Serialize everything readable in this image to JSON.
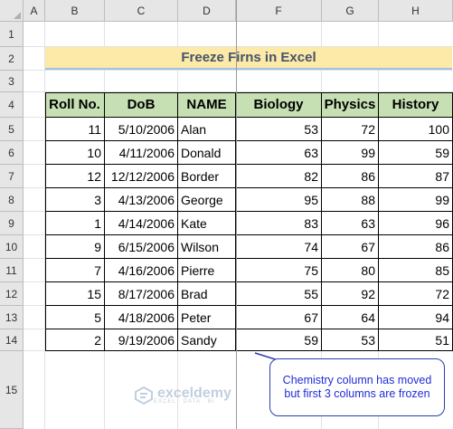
{
  "columns": [
    "A",
    "B",
    "C",
    "D",
    "F",
    "G",
    "H"
  ],
  "rows": [
    "1",
    "2",
    "3",
    "4",
    "5",
    "6",
    "7",
    "8",
    "9",
    "10",
    "11",
    "12",
    "13",
    "14",
    "15"
  ],
  "title": "Freeze Firns in Excel",
  "headers": [
    "Roll No.",
    "DoB",
    "NAME",
    "Biology",
    "Physics",
    "History"
  ],
  "data": [
    [
      "11",
      "5/10/2006",
      "Alan",
      "53",
      "72",
      "100"
    ],
    [
      "10",
      "4/11/2006",
      "Donald",
      "63",
      "99",
      "59"
    ],
    [
      "12",
      "12/12/2006",
      "Border",
      "82",
      "86",
      "87"
    ],
    [
      "3",
      "4/13/2006",
      "George",
      "95",
      "88",
      "99"
    ],
    [
      "1",
      "4/14/2006",
      "Kate",
      "83",
      "63",
      "96"
    ],
    [
      "9",
      "6/15/2006",
      "Wilson",
      "74",
      "67",
      "86"
    ],
    [
      "7",
      "4/16/2006",
      "Pierre",
      "75",
      "80",
      "85"
    ],
    [
      "15",
      "8/17/2006",
      "Brad",
      "55",
      "92",
      "72"
    ],
    [
      "5",
      "4/18/2006",
      "Peter",
      "67",
      "64",
      "94"
    ],
    [
      "2",
      "9/19/2006",
      "Sandy",
      "59",
      "53",
      "51"
    ]
  ],
  "callout": "Chemistry column has moved but first 3 columns are frozen",
  "watermark": {
    "brand": "exceldemy",
    "tagline": "EXCEL · DATA · BI"
  },
  "colors": {
    "header_fill": "#c6e0b4",
    "title_fill": "#fde9a8",
    "callout_text": "#1f2bd8"
  }
}
